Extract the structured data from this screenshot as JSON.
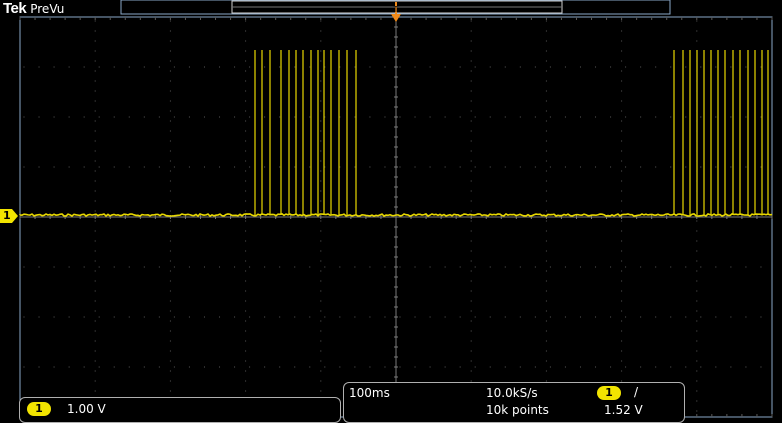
{
  "brand": {
    "logo": "Tek",
    "mode": "PreVu"
  },
  "colors": {
    "trace": "#e8d800",
    "grid": "#5a5a5a",
    "frame": "#8aa8c8",
    "trigger": "#f08a1a",
    "badge": "#f2e400"
  },
  "channel_marker": {
    "label": "1"
  },
  "trigger_marker": {
    "label": "T"
  },
  "channel_readout": {
    "channel": "1",
    "scale": "1.00 V"
  },
  "horizontal_readout": {
    "time_per_div": "100ms",
    "sample_rate": "10.0kS/s",
    "record_length": "10k points",
    "trigger_channel": "1",
    "trigger_slope": "/",
    "trigger_level": "1.52 V"
  }
}
